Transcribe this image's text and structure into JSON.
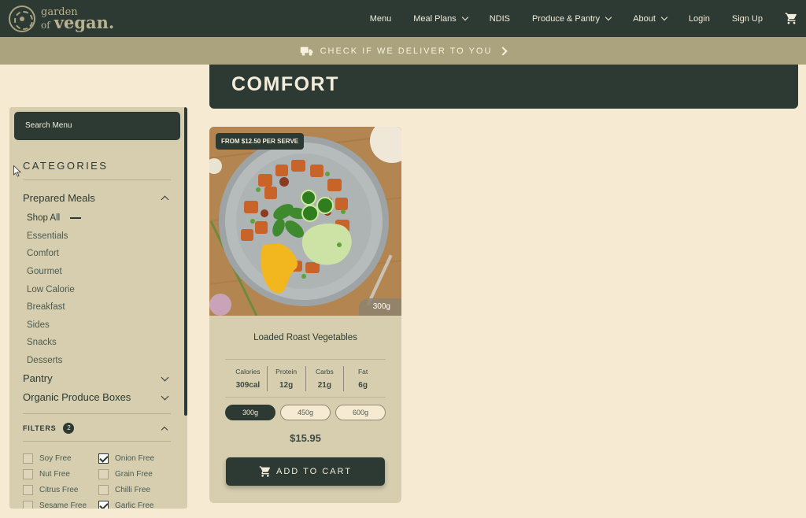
{
  "nav": {
    "logo": {
      "line1": "garden",
      "line2": "of",
      "line3": "vegan."
    },
    "items": [
      {
        "label": "Menu",
        "dropdown": false
      },
      {
        "label": "Meal Plans",
        "dropdown": true
      },
      {
        "label": "NDIS",
        "dropdown": false
      },
      {
        "label": "Produce & Pantry",
        "dropdown": true
      },
      {
        "label": "About",
        "dropdown": true
      },
      {
        "label": "Login",
        "dropdown": false
      },
      {
        "label": "Sign Up",
        "dropdown": false
      }
    ],
    "cart_icon": "cart-icon"
  },
  "delivery_bar": {
    "text": "CHECK IF WE DELIVER TO YOU",
    "icon": "truck-icon"
  },
  "banner": {
    "title": "COMFORT"
  },
  "sidebar": {
    "search_placeholder": "Search Menu",
    "categories_title": "CATEGORIES",
    "groups": [
      {
        "label": "Prepared Meals",
        "expanded": true
      },
      {
        "label": "Pantry",
        "expanded": false
      },
      {
        "label": "Organic Produce Boxes",
        "expanded": false
      }
    ],
    "prepared_meals_items": [
      "Shop All",
      "Essentials",
      "Comfort",
      "Gourmet",
      "Low Calorie",
      "Breakfast",
      "Sides",
      "Snacks",
      "Desserts"
    ],
    "filters": {
      "label": "FILTERS",
      "count": "2",
      "options": [
        {
          "label": "Soy Free",
          "checked": false
        },
        {
          "label": "Onion Free",
          "checked": true
        },
        {
          "label": "Nut Free",
          "checked": false
        },
        {
          "label": "Grain Free",
          "checked": false
        },
        {
          "label": "Citrus Free",
          "checked": false
        },
        {
          "label": "Chilli Free",
          "checked": false
        },
        {
          "label": "Sesame Free",
          "checked": false
        },
        {
          "label": "Garlic Free",
          "checked": true
        }
      ]
    }
  },
  "product": {
    "price_tag": "FROM $12.50 PER SERVE",
    "weight_tag": "300g",
    "name": "Loaded Roast Vegetables",
    "nutrition": [
      {
        "label": "Calories",
        "value": "309cal"
      },
      {
        "label": "Protein",
        "value": "12g"
      },
      {
        "label": "Carbs",
        "value": "21g"
      },
      {
        "label": "Fat",
        "value": "6g"
      }
    ],
    "sizes": [
      {
        "label": "300g",
        "selected": true
      },
      {
        "label": "450g",
        "selected": false
      },
      {
        "label": "600g",
        "selected": false
      }
    ],
    "price": "$15.95",
    "add_to_cart": "ADD TO CART"
  },
  "colors": {
    "primary_dark": "#2c3a33",
    "olive": "#aba37e",
    "sidebar_bg": "#d6ceaf",
    "page_bg": "#f7ead2"
  }
}
